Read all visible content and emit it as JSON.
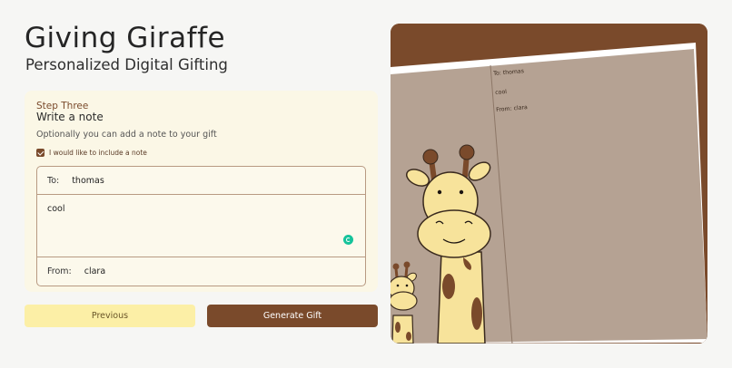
{
  "brand": {
    "title": "Giving Giraffe",
    "subtitle": "Personalized Digital Gifting"
  },
  "step": {
    "label": "Step Three",
    "title": "Write a note",
    "description": "Optionally you can add a note to your gift"
  },
  "note_option": {
    "checked": true,
    "label": "I would like to include a note"
  },
  "note_form": {
    "to_label": "To:",
    "to_value": "thomas",
    "message": "cool",
    "from_label": "From:",
    "from_value": "clara"
  },
  "buttons": {
    "previous": "Previous",
    "generate": "Generate Gift"
  },
  "preview": {
    "to_line": "To: thomas",
    "message": "cool",
    "from_line": "From: clara"
  },
  "colors": {
    "brand_brown": "#7a4a2b",
    "card_cream": "#fbf7e6",
    "previous_yellow": "#fcefa6",
    "page_tan": "#b5a293"
  },
  "icons": [
    "checkbox-checked-icon",
    "grammarly-icon",
    "giraffe-illustration"
  ]
}
